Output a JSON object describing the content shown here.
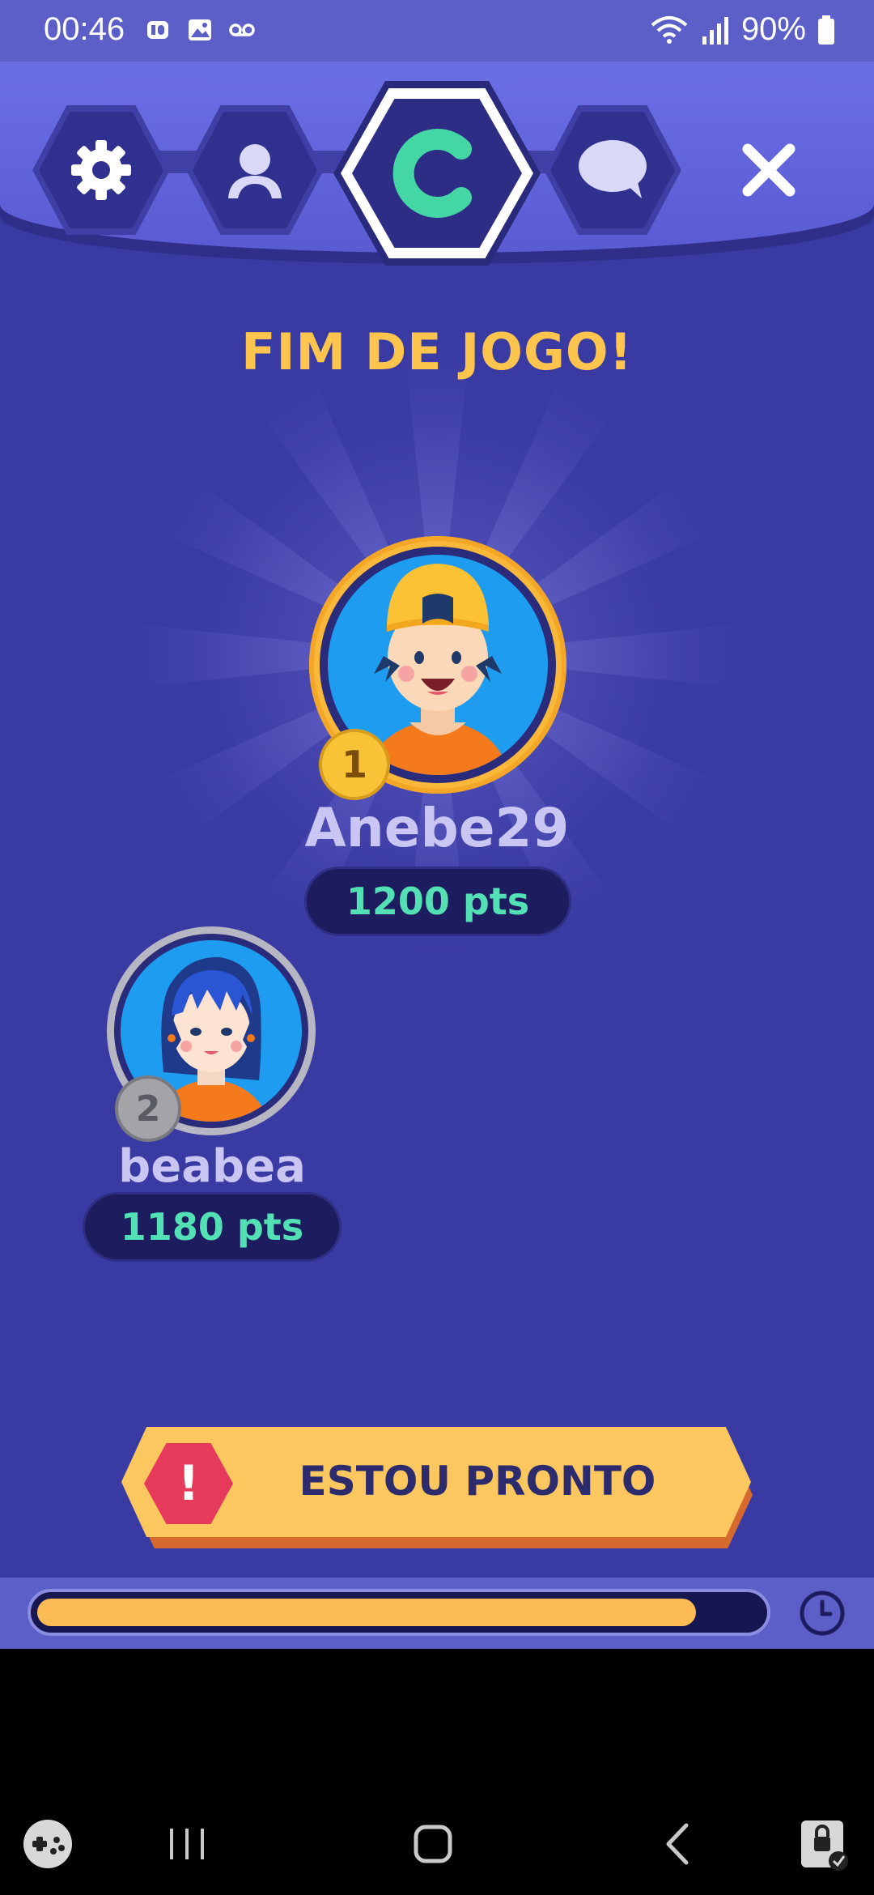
{
  "status_bar": {
    "time": "00:46",
    "battery": "90%",
    "left_icons": [
      "id-icon",
      "gallery-icon",
      "voicemail-icon"
    ],
    "right_icons": [
      "wifi-icon",
      "signal-icon",
      "battery-icon"
    ]
  },
  "header": {
    "tabs": [
      {
        "name": "settings",
        "icon": "gear-icon"
      },
      {
        "name": "profile",
        "icon": "user-icon"
      },
      {
        "name": "game",
        "icon": "c-logo-icon",
        "active": true,
        "label": "C"
      },
      {
        "name": "chat",
        "icon": "chat-icon"
      }
    ],
    "close_icon": "close-icon"
  },
  "title": "FIM DE JOGO!",
  "players": [
    {
      "rank": "1",
      "name": "Anebe29",
      "score": "1200 pts",
      "badge_color": "#f9c338"
    },
    {
      "rank": "2",
      "name": "beabea",
      "score": "1180 pts",
      "badge_color": "#9a9a9a"
    }
  ],
  "ready_button": {
    "label": "ESTOU PRONTO",
    "icon": "alert-icon",
    "icon_text": "!"
  },
  "timer": {
    "progress": 0.91,
    "icon": "clock-icon"
  },
  "nav_bar": {
    "items": [
      "game-launcher-icon",
      "recents-icon",
      "home-icon",
      "back-icon",
      "screen-lock-icon"
    ]
  },
  "colors": {
    "background": "#3a3aa3",
    "header": "#5b5fc7",
    "accent_yellow": "#fdc54e",
    "score_green": "#52e0b4",
    "alert_red": "#e63a5a"
  }
}
